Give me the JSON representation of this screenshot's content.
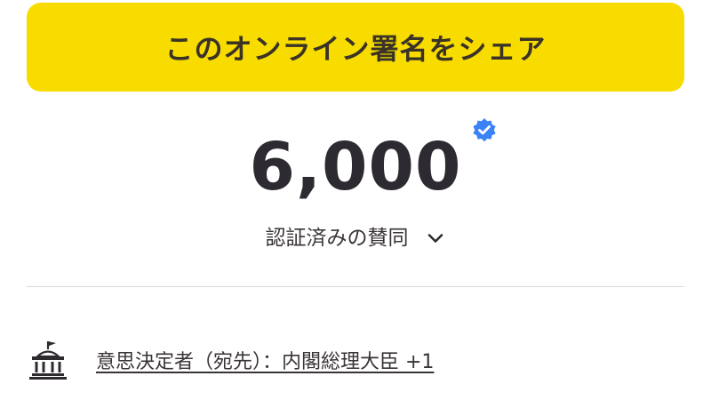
{
  "share": {
    "label": "このオンライン署名をシェア",
    "bg_color": "#f8dc00"
  },
  "signatures": {
    "count": "6,000",
    "verified_icon": "verified-badge-icon",
    "badge_color": "#3b82f6",
    "verified_label": "認証済みの賛同",
    "toggle_icon": "chevron-down-icon"
  },
  "decision_maker": {
    "icon": "government-building-icon",
    "label": "意思決定者（宛先）：内閣総理大臣 +1"
  }
}
